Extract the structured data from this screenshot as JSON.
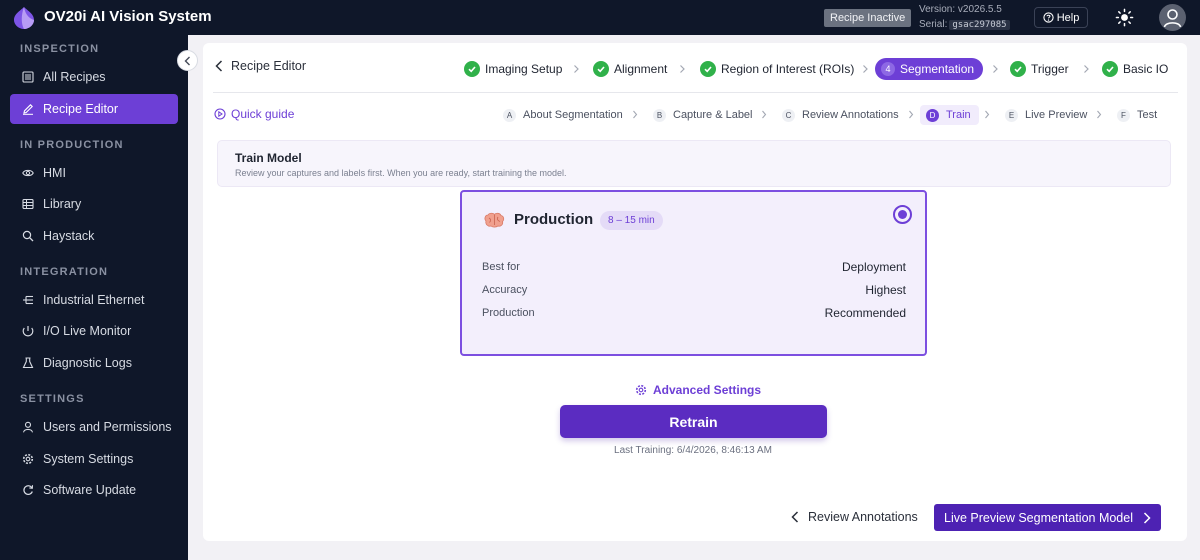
{
  "app": {
    "title": "OV20i AI Vision System"
  },
  "header": {
    "status": "Recipe Inactive",
    "version": "Version: v2026.5.5",
    "serial_label": "Serial:",
    "serial_code": "gsac297085",
    "help_label": "Help"
  },
  "sidebar": {
    "sections": [
      {
        "label": "INSPECTION"
      },
      {
        "label": "IN PRODUCTION"
      },
      {
        "label": "INTEGRATION"
      },
      {
        "label": "SETTINGS"
      }
    ],
    "items": [
      {
        "label": "All Recipes",
        "icon": "list-icon"
      },
      {
        "label": "Recipe Editor",
        "icon": "pencil-icon",
        "active": true
      },
      {
        "label": "HMI",
        "icon": "eye-icon"
      },
      {
        "label": "Library",
        "icon": "grid-icon"
      },
      {
        "label": "Haystack",
        "icon": "search-icon"
      },
      {
        "label": "Industrial Ethernet",
        "icon": "network-icon"
      },
      {
        "label": "I/O Live Monitor",
        "icon": "monitor-icon"
      },
      {
        "label": "Diagnostic Logs",
        "icon": "flask-icon"
      },
      {
        "label": "Users and Permissions",
        "icon": "user-icon"
      },
      {
        "label": "System Settings",
        "icon": "gear-icon"
      },
      {
        "label": "Software Update",
        "icon": "refresh-icon"
      }
    ]
  },
  "editor": {
    "back_label": "Recipe Editor",
    "steps": [
      {
        "label": "Imaging Setup",
        "status": "done"
      },
      {
        "label": "Alignment",
        "status": "done"
      },
      {
        "label": "Region of Interest (ROIs)",
        "status": "done"
      },
      {
        "number": "4",
        "label": "Segmentation",
        "status": "active"
      },
      {
        "label": "Trigger",
        "status": "done"
      },
      {
        "label": "Basic IO",
        "status": "done"
      }
    ],
    "quick_guide": "Quick guide",
    "substeps": [
      {
        "letter": "A",
        "label": "About Segmentation"
      },
      {
        "letter": "B",
        "label": "Capture & Label"
      },
      {
        "letter": "C",
        "label": "Review Annotations"
      },
      {
        "letter": "D",
        "label": "Train",
        "active": true
      },
      {
        "letter": "E",
        "label": "Live Preview"
      },
      {
        "letter": "F",
        "label": "Test"
      }
    ]
  },
  "train": {
    "title": "Train Model",
    "description": "Review your captures and labels first. When you are ready, start training the model."
  },
  "card": {
    "title": "Production",
    "badge": "8 – 15 min",
    "selected": true,
    "rows": [
      {
        "label": "Best for",
        "value": "Deployment"
      },
      {
        "label": "Accuracy",
        "value": "Highest"
      },
      {
        "label": "Production",
        "value": "Recommended"
      }
    ]
  },
  "actions": {
    "advanced": "Advanced Settings",
    "retrain": "Retrain",
    "last_training": "Last Training: 6/4/2026, 8:46:13 AM",
    "back": "Review Annotations",
    "next": "Live Preview Segmentation Model"
  },
  "colors": {
    "accent": "#6d3fd6",
    "sidebar": "#0f1729",
    "success": "#30b14a"
  }
}
